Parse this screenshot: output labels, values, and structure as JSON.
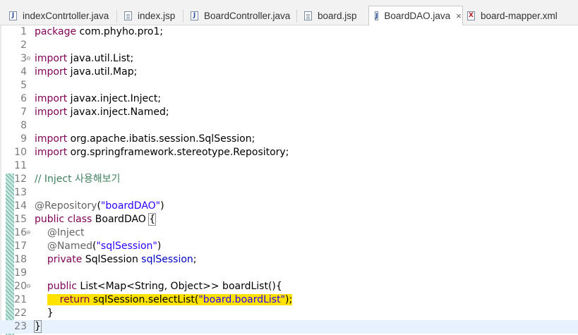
{
  "tabs": [
    {
      "label": "indexContrtoller.java",
      "icon": "java-file-icon",
      "active": false
    },
    {
      "label": "index.jsp",
      "icon": "jsp-file-icon",
      "active": false
    },
    {
      "label": "BoardController.java",
      "icon": "java-file-icon",
      "active": false
    },
    {
      "label": "board.jsp",
      "icon": "jsp-file-icon",
      "active": false
    },
    {
      "label": "BoardDAO.java",
      "icon": "java-file-icon",
      "active": true
    },
    {
      "label": "board-mapper.xml",
      "icon": "xml-file-icon",
      "active": false
    }
  ],
  "close_glyph": "×",
  "editor": {
    "current_line": 23,
    "highlighted_line": 21,
    "lines": [
      {
        "n": "1",
        "text": "package com.phyho.pro1;"
      },
      {
        "n": "2",
        "text": ""
      },
      {
        "n": "3",
        "text": "import java.util.List;",
        "fold": true
      },
      {
        "n": "4",
        "text": "import java.util.Map;"
      },
      {
        "n": "5",
        "text": ""
      },
      {
        "n": "6",
        "text": "import javax.inject.Inject;"
      },
      {
        "n": "7",
        "text": "import javax.inject.Named;"
      },
      {
        "n": "8",
        "text": ""
      },
      {
        "n": "9",
        "text": "import org.apache.ibatis.session.SqlSession;"
      },
      {
        "n": "10",
        "text": "import org.springframework.stereotype.Repository;"
      },
      {
        "n": "11",
        "text": ""
      },
      {
        "n": "12",
        "text": "// Inject 사용해보기"
      },
      {
        "n": "13",
        "text": ""
      },
      {
        "n": "14",
        "text": "@Repository(\"boardDAO\")"
      },
      {
        "n": "15",
        "text": "public class BoardDAO {"
      },
      {
        "n": "16",
        "text": "    @Inject",
        "fold": true
      },
      {
        "n": "17",
        "text": "    @Named(\"sqlSession\")"
      },
      {
        "n": "18",
        "text": "    private SqlSession sqlSession;"
      },
      {
        "n": "19",
        "text": ""
      },
      {
        "n": "20",
        "text": "    public List<Map<String, Object>> boardList(){",
        "fold": true
      },
      {
        "n": "21",
        "text": "        return sqlSession.selectList(\"board.boardList\");"
      },
      {
        "n": "22",
        "text": "    }"
      },
      {
        "n": "23",
        "text": "}"
      }
    ]
  },
  "colors": {
    "keyword": "#7f0055",
    "string": "#2a00ff",
    "comment": "#3f7f5f",
    "annotation": "#646464",
    "field": "#0000c0",
    "highlight": "#ffe200",
    "current_line": "#e8f2fe"
  },
  "icons": {
    "fold_marker": "minus-circle-icon",
    "tab_close": "close-icon"
  }
}
